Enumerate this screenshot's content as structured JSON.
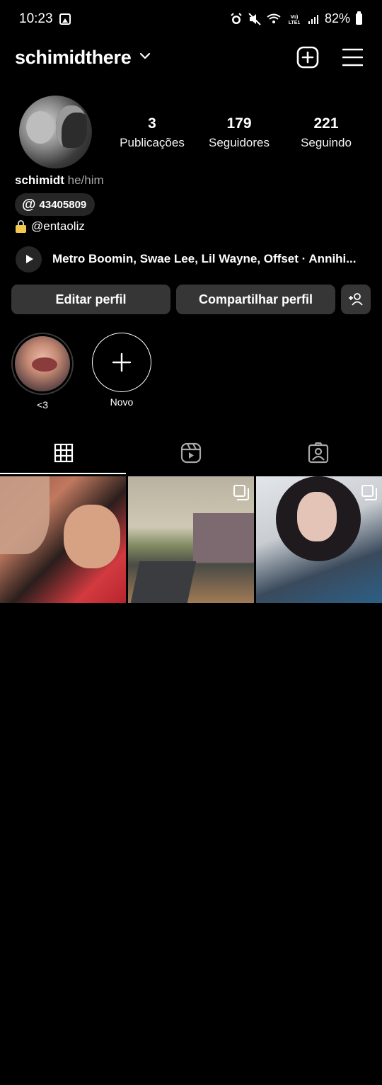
{
  "status_bar": {
    "time": "10:23",
    "battery": "82%",
    "network_label": "Vo) LTE1"
  },
  "header": {
    "username": "schimidthere"
  },
  "profile": {
    "stats": [
      {
        "value": "3",
        "label": "Publicações"
      },
      {
        "value": "179",
        "label": "Seguidores"
      },
      {
        "value": "221",
        "label": "Seguindo"
      }
    ],
    "name": "schimidt",
    "pronouns": "he/him",
    "threads_badge": "43405809",
    "bio_handle": "@entaoliz",
    "music": "Metro Boomin, Swae Lee, Lil Wayne, Offset · Annihi..."
  },
  "buttons": {
    "edit": "Editar perfil",
    "share": "Compartilhar perfil"
  },
  "highlights": [
    {
      "label": "<3"
    },
    {
      "label": "Novo"
    }
  ],
  "tabs": [
    {
      "icon": "grid-icon",
      "selected": true
    },
    {
      "icon": "reels-icon",
      "selected": false
    },
    {
      "icon": "tagged-icon",
      "selected": false
    }
  ],
  "posts": [
    {
      "multi": false
    },
    {
      "multi": true
    },
    {
      "multi": true
    }
  ],
  "colors": {
    "background": "#000000",
    "button": "#363636",
    "badge": "#262626",
    "secondary_text": "#a8a8a8"
  }
}
